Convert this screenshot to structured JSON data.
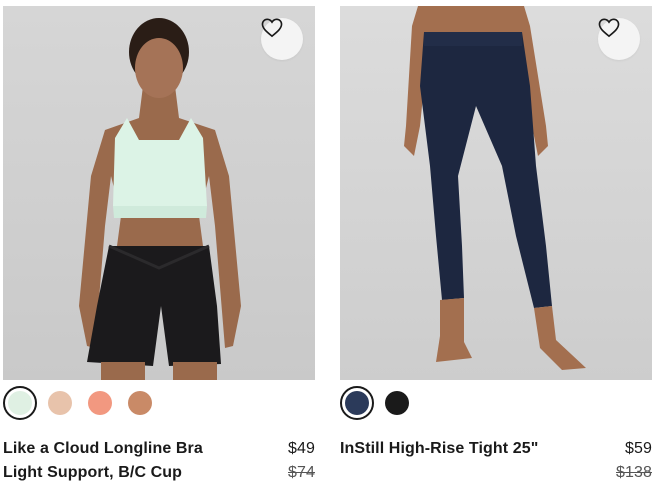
{
  "products": [
    {
      "name_line1": "Like a Cloud Longline Bra",
      "name_line2": "Light Support, B/C Cup",
      "price": "$49",
      "original_price": "$74",
      "swatch_colors": [
        "#dff0e3",
        "#e8c3ab",
        "#f29880",
        "#c98a67"
      ],
      "selected_swatch": 0,
      "favorite_icon": "heart-outline-icon"
    },
    {
      "name_line1": "InStill High-Rise Tight 25\"",
      "price": "$59",
      "original_price": "$138",
      "swatch_colors": [
        "#2b3a5a",
        "#1a1a1a"
      ],
      "selected_swatch": 0,
      "favorite_icon": "heart-outline-icon"
    }
  ]
}
